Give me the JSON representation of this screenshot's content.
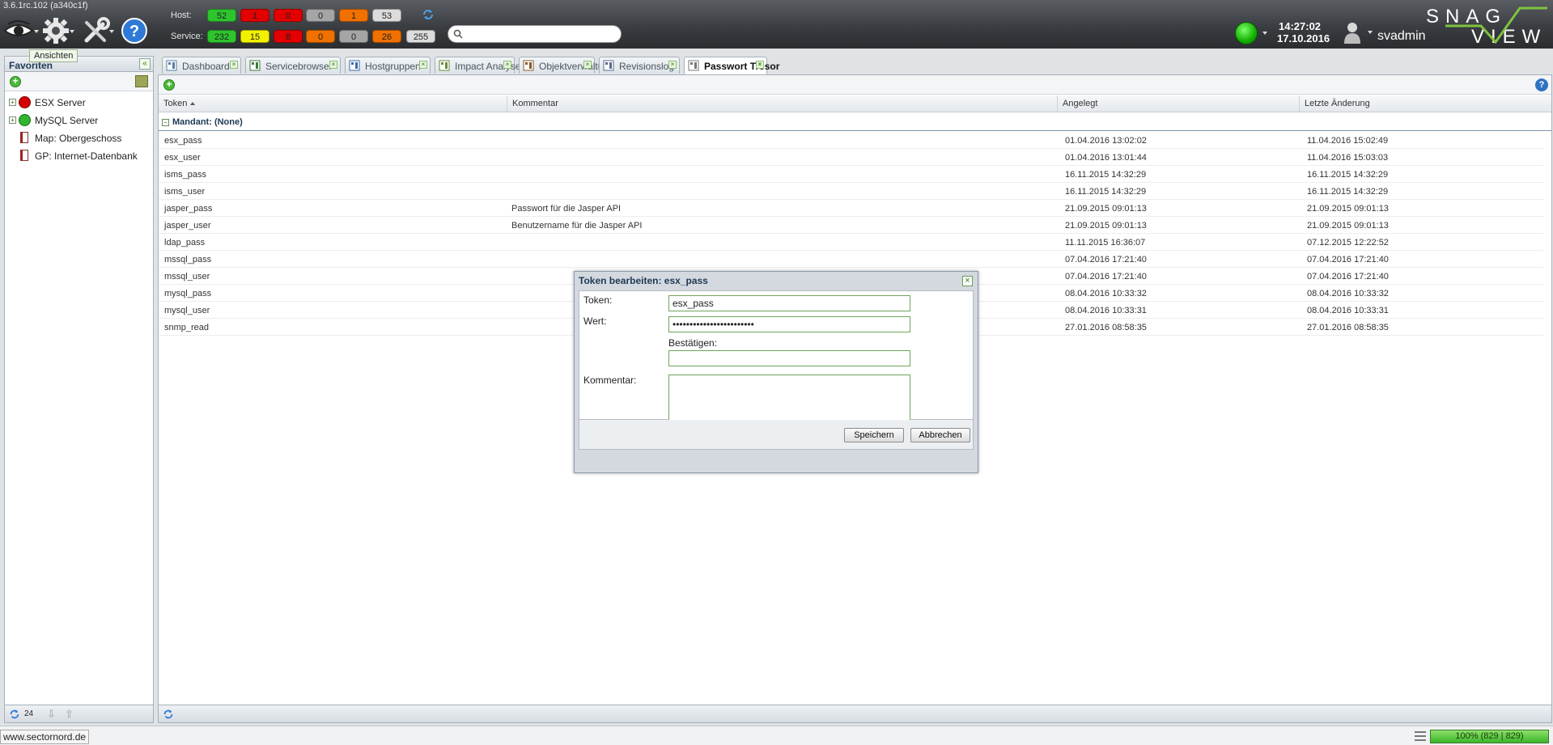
{
  "app": {
    "version": "3.6.1rc.102 (a340c1f)"
  },
  "toolbar": {
    "tooltip": "Ansichten"
  },
  "host_counters": {
    "label": "Host:",
    "values": [
      {
        "value": "52",
        "color": "#2dc52d"
      },
      {
        "value": "1",
        "color": "#e20000"
      },
      {
        "value": "0",
        "color": "#e20000"
      },
      {
        "value": "0",
        "color": "#a5a5a5"
      },
      {
        "value": "1",
        "color": "#f07000"
      },
      {
        "value": "53",
        "color": "#dcdcdc"
      }
    ]
  },
  "service_counters": {
    "label": "Service:",
    "values": [
      {
        "value": "232",
        "color": "#2dc52d"
      },
      {
        "value": "15",
        "color": "#f2f200"
      },
      {
        "value": "8",
        "color": "#e20000"
      },
      {
        "value": "0",
        "color": "#f07000"
      },
      {
        "value": "0",
        "color": "#a5a5a5"
      },
      {
        "value": "26",
        "color": "#f07000"
      },
      {
        "value": "255",
        "color": "#dcdcdc"
      }
    ]
  },
  "search": {
    "value": "",
    "placeholder": ""
  },
  "clock": {
    "time": "14:27:02",
    "date": "17.10.2016"
  },
  "user": {
    "name": "svadmin"
  },
  "logo": {
    "text_top": "SNAG",
    "text_bottom": "VIEW"
  },
  "favorites": {
    "title": "Favoriten",
    "items": [
      {
        "label": "ESX Server",
        "icon": "status-red-icon"
      },
      {
        "label": "MySQL Server",
        "icon": "status-green-icon"
      },
      {
        "label": "Map: Obergeschoss",
        "icon": "map-icon"
      },
      {
        "label": "GP: Internet-Datenbank",
        "icon": "map-icon"
      }
    ],
    "footer_count": "24"
  },
  "tabs": [
    {
      "label": "Dashboard",
      "icon": "dashboard-icon"
    },
    {
      "label": "Servicebrowser",
      "icon": "servicebrowser-icon"
    },
    {
      "label": "Hostgruppen",
      "icon": "hostgroups-icon"
    },
    {
      "label": "Impact Analyser",
      "icon": "impact-icon"
    },
    {
      "label": "Objektverwaltung",
      "icon": "objects-icon"
    },
    {
      "label": "Revisionslog",
      "icon": "revisionlog-icon"
    },
    {
      "label": "Passwort Tresor",
      "icon": "key-icon",
      "active": true
    }
  ],
  "grid": {
    "columns": [
      "Token",
      "Kommentar",
      "Angelegt",
      "Letzte Änderung"
    ],
    "group_label": "Mandant: (None)",
    "rows": [
      {
        "token": "esx_pass",
        "comment": "",
        "created": "01.04.2016 13:02:02",
        "modified": "11.04.2016 15:02:49"
      },
      {
        "token": "esx_user",
        "comment": "",
        "created": "01.04.2016 13:01:44",
        "modified": "11.04.2016 15:03:03"
      },
      {
        "token": "isms_pass",
        "comment": "",
        "created": "16.11.2015 14:32:29",
        "modified": "16.11.2015 14:32:29"
      },
      {
        "token": "isms_user",
        "comment": "",
        "created": "16.11.2015 14:32:29",
        "modified": "16.11.2015 14:32:29"
      },
      {
        "token": "jasper_pass",
        "comment": "Passwort für die Jasper API",
        "created": "21.09.2015 09:01:13",
        "modified": "21.09.2015 09:01:13"
      },
      {
        "token": "jasper_user",
        "comment": "Benutzername für die Jasper API",
        "created": "21.09.2015 09:01:13",
        "modified": "21.09.2015 09:01:13"
      },
      {
        "token": "ldap_pass",
        "comment": "",
        "created": "11.11.2015 16:36:07",
        "modified": "07.12.2015 12:22:52"
      },
      {
        "token": "mssql_pass",
        "comment": "",
        "created": "07.04.2016 17:21:40",
        "modified": "07.04.2016 17:21:40"
      },
      {
        "token": "mssql_user",
        "comment": "",
        "created": "07.04.2016 17:21:40",
        "modified": "07.04.2016 17:21:40"
      },
      {
        "token": "mysql_pass",
        "comment": "",
        "created": "08.04.2016 10:33:32",
        "modified": "08.04.2016 10:33:32"
      },
      {
        "token": "mysql_user",
        "comment": "",
        "created": "08.04.2016 10:33:31",
        "modified": "08.04.2016 10:33:31"
      },
      {
        "token": "snmp_read",
        "comment": "",
        "created": "27.01.2016 08:58:35",
        "modified": "27.01.2016 08:58:35"
      }
    ]
  },
  "dialog": {
    "title": "Token bearbeiten: esx_pass",
    "token_label": "Token:",
    "token_value": "esx_pass",
    "value_label": "Wert:",
    "value_masked": "••••••••••••••••••••••••",
    "confirm_label": "Bestätigen:",
    "confirm_value": "",
    "comment_label": "Kommentar:",
    "comment_value": "",
    "save_label": "Speichern",
    "cancel_label": "Abbrechen"
  },
  "statusbar": {
    "url": "www.sectornord.de",
    "progress": "100% (829 | 829)",
    "progress_fraction": 1.0
  }
}
